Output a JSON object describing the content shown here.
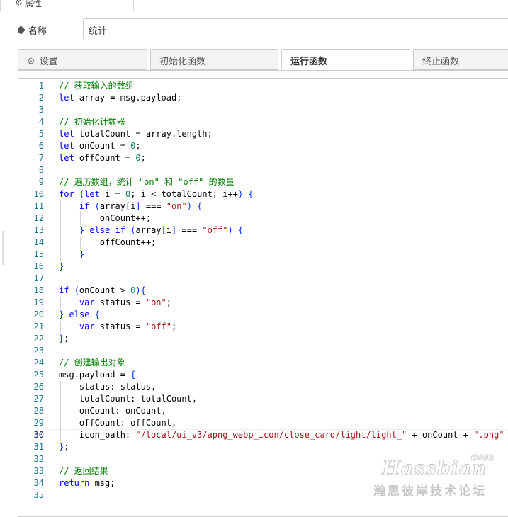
{
  "top_tab": {
    "icon": "gear-icon",
    "label": "属性"
  },
  "name_field": {
    "icon": "tag-icon",
    "label": "名称",
    "value": "统计"
  },
  "tabs": [
    {
      "icon": "gear-icon",
      "label": "设置"
    },
    {
      "label": "初始化函数"
    },
    {
      "label": "运行函数",
      "active": true
    },
    {
      "label": "终止函数"
    }
  ],
  "editor": {
    "current_line": 30,
    "line_numbers": [
      "1",
      "2",
      "3",
      "4",
      "5",
      "6",
      "7",
      "8",
      "9",
      "10",
      "11",
      "12",
      "13",
      "14",
      "15",
      "16",
      "17",
      "18",
      "19",
      "20",
      "21",
      "22",
      "23",
      "24",
      "25",
      "26",
      "27",
      "28",
      "29",
      "30",
      "31",
      "32",
      "33",
      "34",
      "35"
    ],
    "lines": [
      "// 获取输入的数组",
      "let array = msg.payload;",
      "",
      "// 初始化计数器",
      "let totalCount = array.length;",
      "let onCount = 0;",
      "let offCount = 0;",
      "",
      "// 遍历数组，统计 \"on\" 和 \"off\" 的数量",
      "for (let i = 0; i < totalCount; i++) {",
      "    if (array[i] === \"on\") {",
      "        onCount++;",
      "    } else if (array[i] === \"off\") {",
      "        offCount++;",
      "    }",
      "}",
      "",
      "if (onCount > 0){",
      "    var status = \"on\";",
      "} else {",
      "    var status = \"off\";",
      "};",
      "",
      "// 创建输出对象",
      "msg.payload = {",
      "    status: status,",
      "    totalCount: totalCount,",
      "    onCount: onCount,",
      "    offCount: offCount,",
      "    icon_path: \"/local/ui_v3/apng_webp_icon/close_card/light/light_\" + onCount + \".png\"",
      "};",
      "",
      "// 返回结果",
      "return msg;",
      ""
    ]
  },
  "watermark": {
    "brand": "Hassbian",
    "suffix": "com",
    "subtitle": "瀚思彼岸技术论坛"
  },
  "colors": {
    "keyword": "#0000ff",
    "comment": "#008000",
    "string": "#a31515",
    "number": "#098658",
    "line_number": "#237893"
  }
}
